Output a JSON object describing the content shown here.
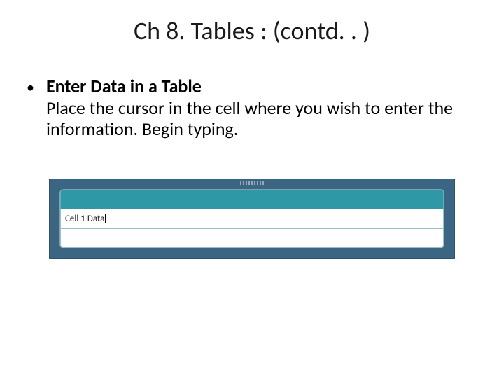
{
  "title": "Ch 8. Tables : (contd. . )",
  "bullet": {
    "heading": "Enter Data in a Table",
    "text": "Place the cursor in the cell where you wish to enter the information.  Begin typing."
  },
  "table": {
    "cell_value": "Cell 1 Data"
  },
  "colors": {
    "figure_bg": "#3a6684",
    "header_cell": "#2f98a6"
  }
}
